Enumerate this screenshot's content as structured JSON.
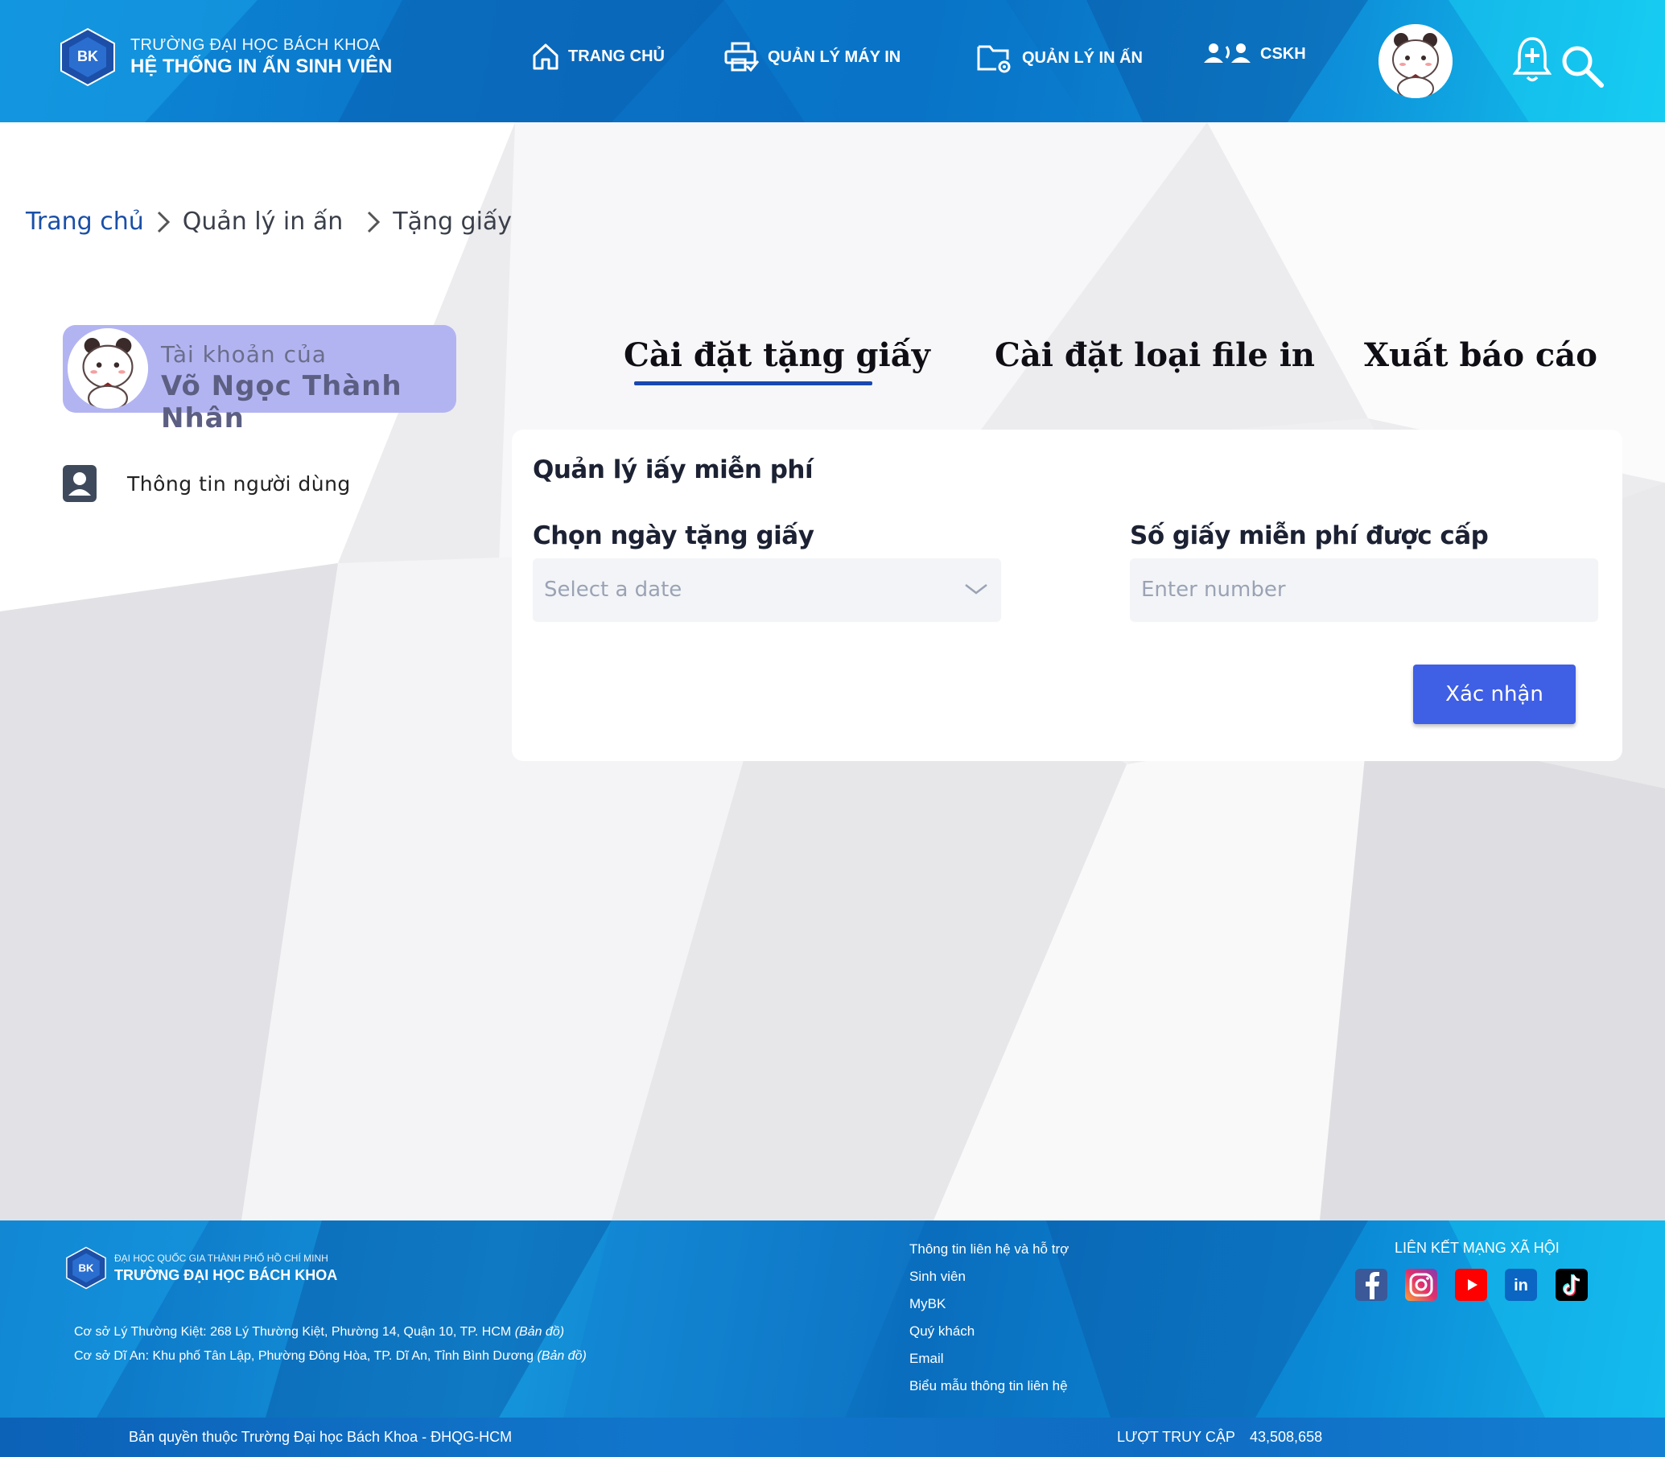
{
  "header": {
    "brand_sub": "TRƯỜNG ĐẠI HỌC BÁCH KHOA",
    "brand_main": "HỆ THỐNG IN ẤN SINH VIÊN",
    "logo_text": "BK",
    "nav": [
      {
        "label": "TRANG CHỦ",
        "icon": "home-icon"
      },
      {
        "label": "QUẢN LÝ MÁY IN",
        "icon": "printer-icon"
      },
      {
        "label": "QUẢN LÝ IN ẤN",
        "icon": "folder-settings-icon"
      },
      {
        "label": "CSKH",
        "icon": "support-users-icon"
      }
    ]
  },
  "breadcrumb": {
    "home": "Trang chủ",
    "level1": "Quản lý in ấn",
    "level2": "Tặng giấy"
  },
  "sidebar": {
    "account_label": "Tài khoản của",
    "account_name": "Võ Ngọc Thành Nhân",
    "user_info": "Thông tin người dùng"
  },
  "tabs": [
    {
      "label": "Cài đặt tặng giấy",
      "active": true
    },
    {
      "label": "Cài đặt loại file in",
      "active": false
    },
    {
      "label": "Xuất báo cáo",
      "active": false
    }
  ],
  "form": {
    "title": "Quản lý iấy miễn phí",
    "date_label": "Chọn ngày tặng giấy",
    "date_placeholder": "Select a date",
    "number_label": "Số giấy miễn phí được cấp",
    "number_placeholder": "Enter number",
    "confirm_label": "Xác nhận"
  },
  "footer": {
    "org_small": "ĐẠI HỌC QUỐC GIA THÀNH PHỐ HỒ CHÍ MINH",
    "org_big": "TRƯỜNG ĐẠI HỌC BÁCH KHOA",
    "address1": "Cơ sở Lý Thường Kiệt: 268 Lý Thường Kiệt, Phường 14, Quận 10, TP. HCM",
    "address2": "Cơ sở Dĩ An: Khu phố Tân Lập, Phường Đông Hòa, TP. Dĩ An, Tỉnh Bình Dương",
    "map_link": "(Bản đồ)",
    "links": [
      "Thông tin liên hệ và hỗ trợ",
      "Sinh viên",
      "MyBK",
      "Quý khách",
      "Email",
      "Biểu mẫu thông tin liên hệ"
    ],
    "social_title": "LIÊN KẾT MẠNG XÃ HỘI",
    "social": [
      "facebook-icon",
      "instagram-icon",
      "youtube-icon",
      "linkedin-icon",
      "tiktok-icon"
    ],
    "copyright": "Bản quyền thuộc Trường Đại học Bách Khoa - ĐHQG-HCM",
    "visits_label": "LƯỢT TRUY CẬP",
    "visits_value": "43,508,658"
  },
  "colors": {
    "accent": "#3f5fe5",
    "account_card": "#b2b4f2",
    "tab_underline": "#1a48b0",
    "breadcrumb_home": "#1a4fa8"
  }
}
